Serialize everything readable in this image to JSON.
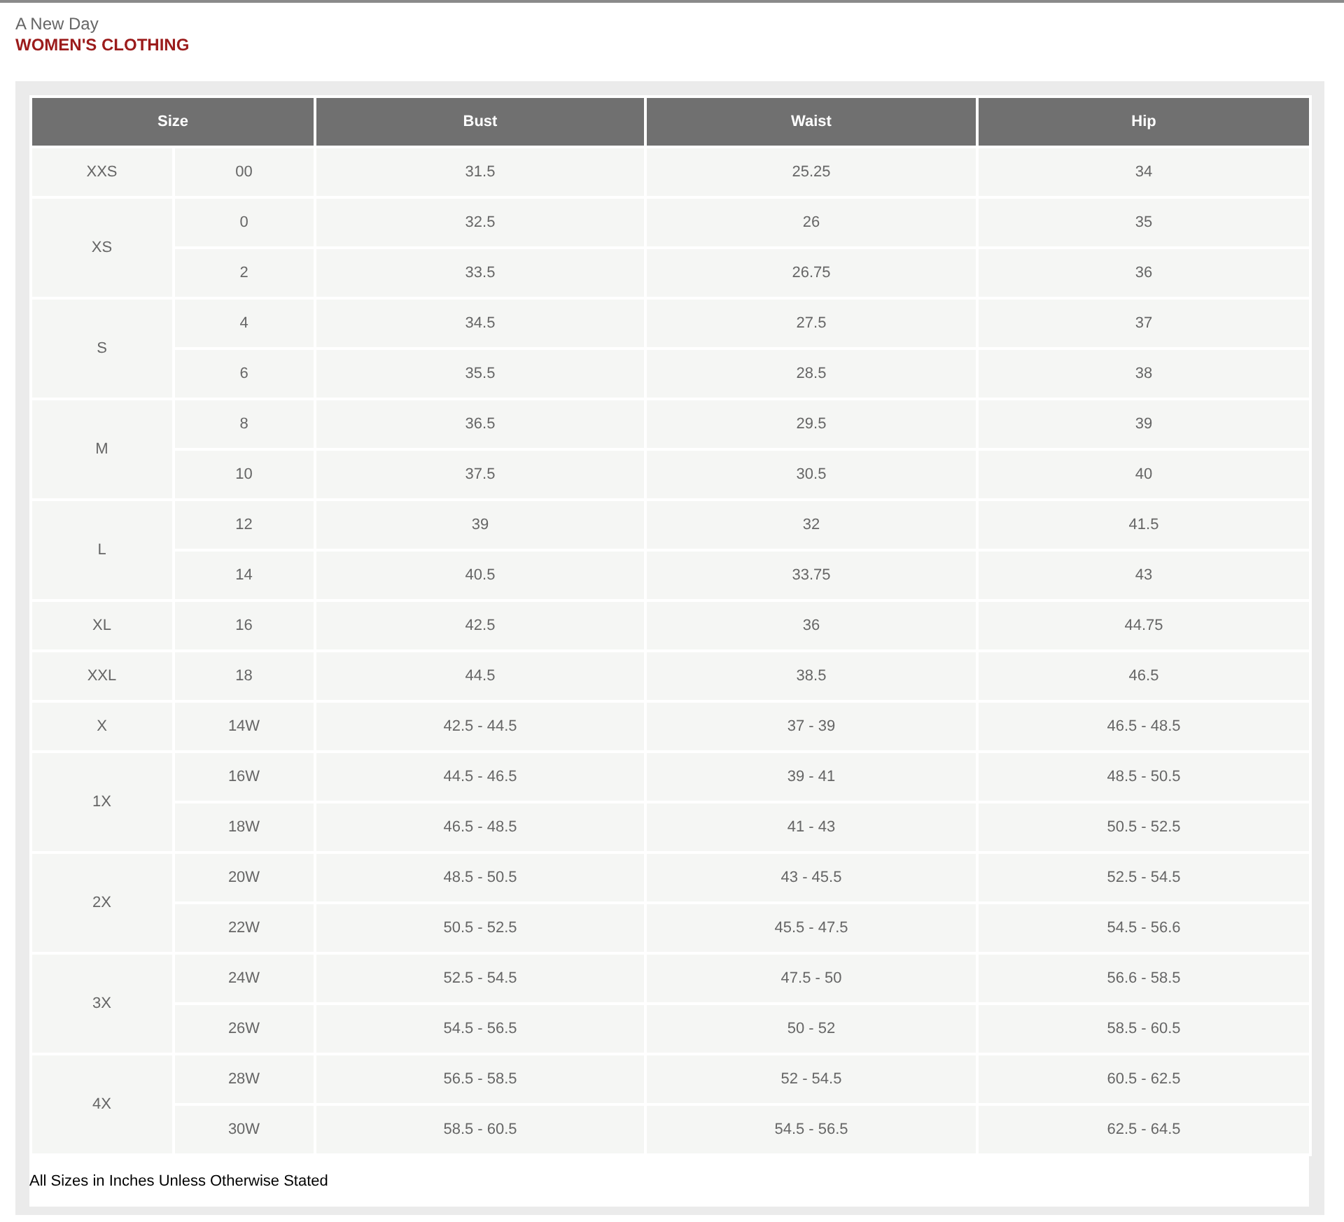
{
  "brand": "A New Day",
  "title": "WOMEN'S CLOTHING",
  "table": {
    "columns": [
      "Size",
      "Bust",
      "Waist",
      "Hip"
    ],
    "groups": [
      {
        "size": "XXS",
        "rows": [
          [
            "00",
            "31.5",
            "25.25",
            "34"
          ]
        ]
      },
      {
        "size": "XS",
        "rows": [
          [
            "0",
            "32.5",
            "26",
            "35"
          ],
          [
            "2",
            "33.5",
            "26.75",
            "36"
          ]
        ]
      },
      {
        "size": "S",
        "rows": [
          [
            "4",
            "34.5",
            "27.5",
            "37"
          ],
          [
            "6",
            "35.5",
            "28.5",
            "38"
          ]
        ]
      },
      {
        "size": "M",
        "rows": [
          [
            "8",
            "36.5",
            "29.5",
            "39"
          ],
          [
            "10",
            "37.5",
            "30.5",
            "40"
          ]
        ]
      },
      {
        "size": "L",
        "rows": [
          [
            "12",
            "39",
            "32",
            "41.5"
          ],
          [
            "14",
            "40.5",
            "33.75",
            "43"
          ]
        ]
      },
      {
        "size": "XL",
        "rows": [
          [
            "16",
            "42.5",
            "36",
            "44.75"
          ]
        ]
      },
      {
        "size": "XXL",
        "rows": [
          [
            "18",
            "44.5",
            "38.5",
            "46.5"
          ]
        ]
      },
      {
        "size": "X",
        "rows": [
          [
            "14W",
            "42.5 - 44.5",
            "37 - 39",
            "46.5 - 48.5"
          ]
        ]
      },
      {
        "size": "1X",
        "rows": [
          [
            "16W",
            "44.5 - 46.5",
            "39 - 41",
            "48.5 - 50.5"
          ],
          [
            "18W",
            "46.5 - 48.5",
            "41 - 43",
            "50.5 - 52.5"
          ]
        ]
      },
      {
        "size": "2X",
        "rows": [
          [
            "20W",
            "48.5 - 50.5",
            "43 - 45.5",
            "52.5 - 54.5"
          ],
          [
            "22W",
            "50.5 - 52.5",
            "45.5 - 47.5",
            "54.5 - 56.6"
          ]
        ]
      },
      {
        "size": "3X",
        "rows": [
          [
            "24W",
            "52.5 - 54.5",
            "47.5 - 50",
            "56.6 - 58.5"
          ],
          [
            "26W",
            "54.5 - 56.5",
            "50 - 52",
            "58.5 - 60.5"
          ]
        ]
      },
      {
        "size": "4X",
        "rows": [
          [
            "28W",
            "56.5 - 58.5",
            "52 - 54.5",
            "60.5 - 62.5"
          ],
          [
            "30W",
            "58.5 - 60.5",
            "54.5 - 56.5",
            "62.5 - 64.5"
          ]
        ]
      }
    ],
    "footnote": "All Sizes in Inches Unless Otherwise Stated"
  }
}
